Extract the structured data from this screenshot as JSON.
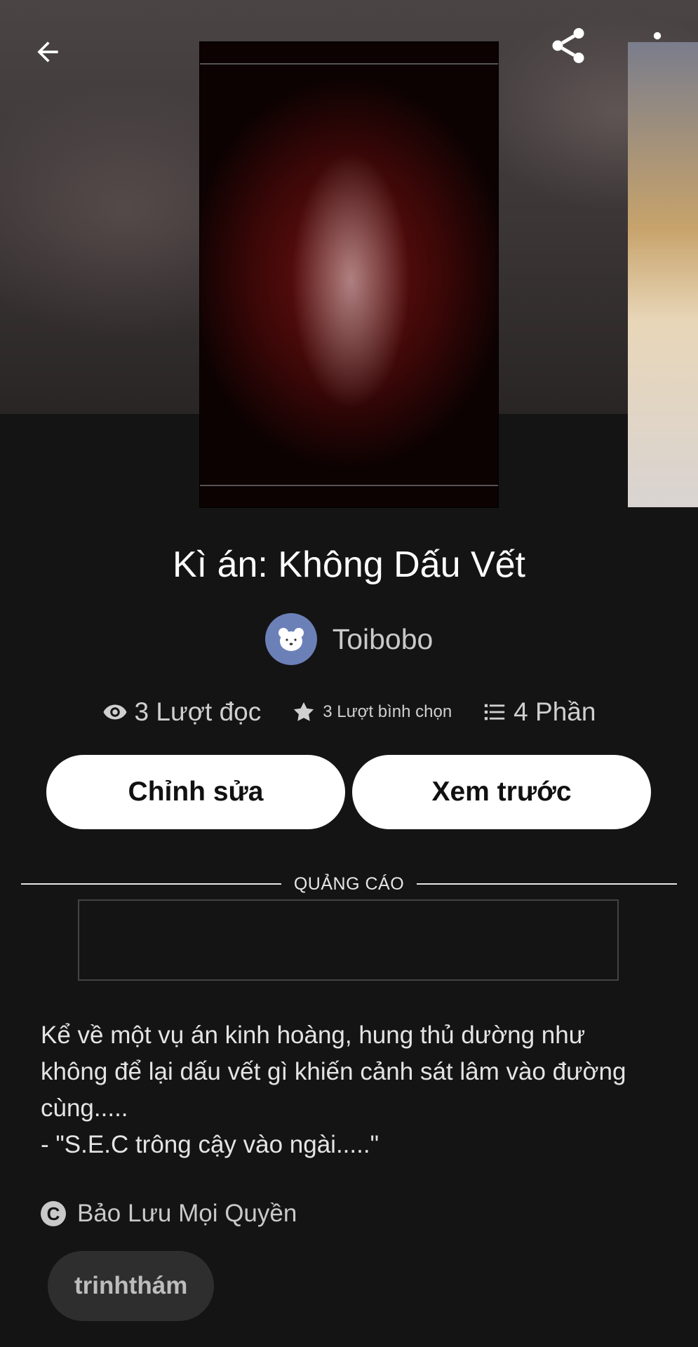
{
  "story": {
    "title": "Kì án: Không Dấu Vết",
    "author": "Toibobo"
  },
  "stats": {
    "reads": "3 Lượt đọc",
    "votes": "3 Lượt bình chọn",
    "parts": "4 Phần"
  },
  "actions": {
    "edit_label": "Chỉnh sửa",
    "preview_label": "Xem trước"
  },
  "ad": {
    "label": "QUẢNG CÁO"
  },
  "description": {
    "line1": "Kể về một vụ án kinh hoàng, hung thủ dường như không để lại dấu vết gì khiến cảnh sát lâm vào đường cùng.....",
    "line2": "- \"S.E.C trông cậy vào ngài.....\""
  },
  "copyright": {
    "text": "Bảo Lưu Mọi Quyền"
  },
  "tags": [
    "trinhthám"
  ],
  "icons": {
    "back": "back-arrow-icon",
    "share": "share-icon",
    "more": "more-vertical-icon",
    "reads": "eye-icon",
    "votes": "star-icon",
    "parts": "list-icon",
    "copyright": "copyright-icon"
  },
  "colors": {
    "background": "#141414",
    "avatar": "#6c80b8",
    "button": "#ffffff",
    "tag_background": "#2e2e2e"
  }
}
